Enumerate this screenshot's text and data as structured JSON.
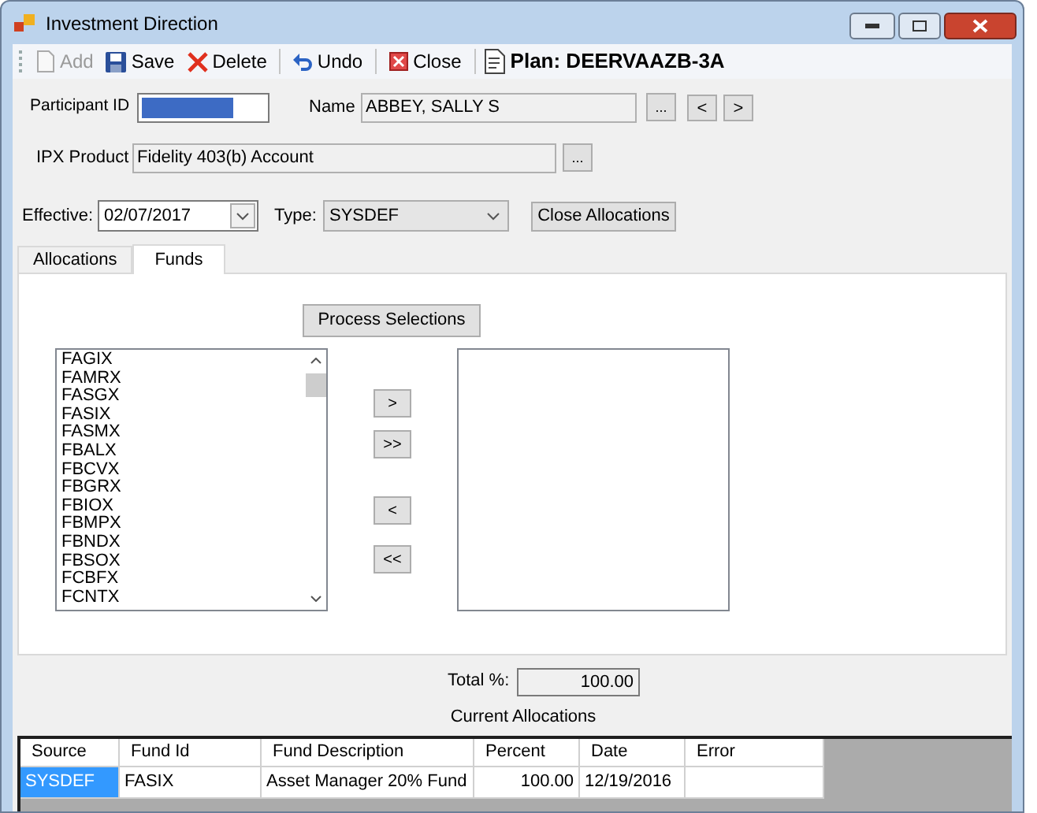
{
  "window": {
    "title": "Investment Direction"
  },
  "toolbar": [
    {
      "label": "Add",
      "kind": "add",
      "disabled": true
    },
    {
      "label": "Save",
      "kind": "save",
      "disabled": false
    },
    {
      "label": "Delete",
      "kind": "delete",
      "disabled": false
    },
    {
      "label": "Undo",
      "kind": "undo",
      "disabled": false
    },
    {
      "label": "Close",
      "kind": "close",
      "disabled": false
    }
  ],
  "plan": "Plan: DEERVAAZB-3A",
  "participant": {
    "label": "Participant ID",
    "value_selected": true,
    "name_label": "Name",
    "name": "ABBEY, SALLY S",
    "lookup": "...",
    "prev": "<",
    "next": ">"
  },
  "product": {
    "label": "IPX Product",
    "value": "Fidelity 403(b) Account",
    "lookup": "..."
  },
  "effective": {
    "label": "Effective:",
    "value": "02/07/2017"
  },
  "type": {
    "label": "Type:",
    "value": "SYSDEF"
  },
  "close_allocations": "Close Allocations",
  "tabs": [
    {
      "label": "Allocations",
      "selected": false
    },
    {
      "label": "Funds",
      "selected": true
    }
  ],
  "process_selections": "Process Selections",
  "available_funds": [
    "FAGIX",
    "FAMRX",
    "FASGX",
    "FASIX",
    "FASMX",
    "FBALX",
    "FBCVX",
    "FBGRX",
    "FBIOX",
    "FBMPX",
    "FBNDX",
    "FBSOX",
    "FCBFX",
    "FCNTX"
  ],
  "move_buttons": [
    ">",
    ">>",
    "<",
    "<<"
  ],
  "total": {
    "label": "Total %:",
    "value": "100.00"
  },
  "current_allocations": {
    "title": "Current Allocations",
    "columns": [
      "Source",
      "Fund Id",
      "Fund Description",
      "Percent",
      "Date",
      "Error"
    ],
    "rows": [
      {
        "selected": true,
        "cells": [
          "SYSDEF",
          "FASIX",
          "Asset Manager 20% Fund",
          "100.00",
          "12/19/2016",
          ""
        ]
      }
    ]
  }
}
